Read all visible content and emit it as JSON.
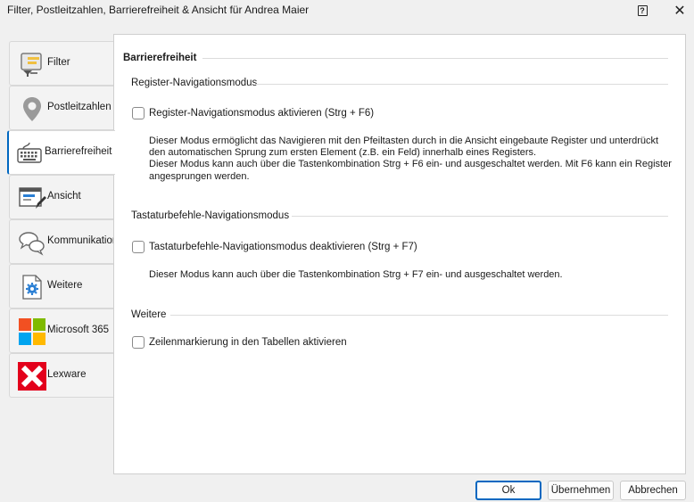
{
  "window": {
    "title": "Filter, Postleitzahlen, Barrierefreiheit & Ansicht für Andrea Maier",
    "help_label": "?",
    "close_label": "✕"
  },
  "sidebar": {
    "items": [
      {
        "label": "Filter",
        "icon": "filter-icon"
      },
      {
        "label": "Postleitzahlen",
        "icon": "map-pin-icon"
      },
      {
        "label": "Barrierefreiheit",
        "icon": "keyboard-icon",
        "active": true
      },
      {
        "label": "Ansicht",
        "icon": "view-edit-icon"
      },
      {
        "label": "Kommunikation",
        "icon": "chat-bubbles-icon"
      },
      {
        "label": "Weitere",
        "icon": "settings-document-icon"
      },
      {
        "label": "Microsoft 365",
        "icon": "microsoft-logo-icon"
      },
      {
        "label": "Lexware",
        "icon": "lexware-logo-icon"
      }
    ]
  },
  "main": {
    "section_title": "Barrierefreiheit",
    "register_group": {
      "title": "Register-Navigationsmodus",
      "checkbox_label": "Register-Navigationsmodus aktivieren (Strg + F6)",
      "checked": false,
      "description_1": "Dieser Modus ermöglicht das Navigieren mit den Pfeiltasten durch in die Ansicht eingebaute Register und unterdrückt den automatischen Sprung zum ersten Element (z.B. ein Feld) innerhalb eines Registers.",
      "description_2": "Dieser Modus kann auch über die Tastenkombination Strg + F6 ein- und ausgeschaltet werden. Mit F6 kann ein Register angesprungen werden."
    },
    "keyboard_group": {
      "title": "Tastaturbefehle-Navigationsmodus",
      "checkbox_label": "Tastaturbefehle-Navigationsmodus deaktivieren (Strg + F7)",
      "checked": false,
      "description": "Dieser Modus kann auch über die Tastenkombination Strg + F7 ein- und ausgeschaltet werden."
    },
    "other_group": {
      "title": "Weitere",
      "checkbox_label": "Zeilenmarkierung in den Tabellen aktivieren",
      "checked": false
    }
  },
  "footer": {
    "ok_label": "Ok",
    "apply_label": "Übernehmen",
    "cancel_label": "Abbrechen"
  },
  "colors": {
    "accent": "#0067c0",
    "ms_red": "#f25022",
    "ms_green": "#7fba00",
    "ms_blue": "#00a4ef",
    "ms_yellow": "#ffb900",
    "lexware_red": "#e3001b"
  }
}
